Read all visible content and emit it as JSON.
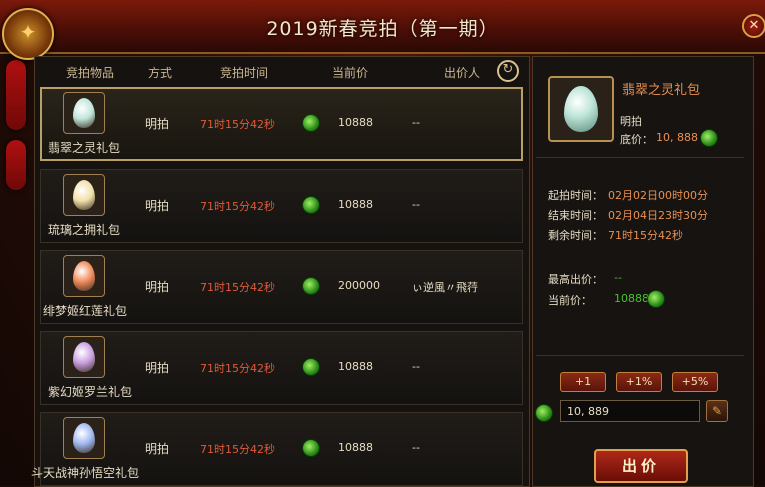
{
  "window": {
    "title": "2019新春竞拍（第一期）"
  },
  "columns": {
    "item": "竞拍物品",
    "mode": "方式",
    "time": "竞拍时间",
    "price": "当前价",
    "bidder": "出价人"
  },
  "rows": [
    {
      "name": "翡翠之灵礼包",
      "mode": "明拍",
      "time": "71时15分42秒",
      "price": "10888",
      "bidder": "--",
      "egg_color": "#bfe6d8"
    },
    {
      "name": "琉璃之拥礼包",
      "mode": "明拍",
      "time": "71时15分42秒",
      "price": "10888",
      "bidder": "--",
      "egg_color": "#f0e0a8"
    },
    {
      "name": "绯梦姬红莲礼包",
      "mode": "明拍",
      "time": "71时15分42秒",
      "price": "200000",
      "bidder": "ぃ逆風〃飛荇",
      "egg_color": "#f08a5a"
    },
    {
      "name": "紫幻姬罗兰礼包",
      "mode": "明拍",
      "time": "71时15分42秒",
      "price": "10888",
      "bidder": "--",
      "egg_color": "#c8a0e0"
    },
    {
      "name": "斗天战神孙悟空礼包",
      "mode": "明拍",
      "time": "71时15分42秒",
      "price": "10888",
      "bidder": "--",
      "egg_color": "#a0b8f0"
    }
  ],
  "detail": {
    "name": "翡翠之灵礼包",
    "mode": "明拍",
    "base_label": "底价：",
    "base_value": "10, 888",
    "start_label": "起拍时间：",
    "start_value": "02月02日00时00分",
    "end_label": "结束时间：",
    "end_value": "02月04日23时30分",
    "remain_label": "剩余时间：",
    "remain_value": "71时15分42秒",
    "highest_label": "最高出价：",
    "highest_value": "--",
    "current_label": "当前价：",
    "current_value": "10888"
  },
  "increments": [
    "+1",
    "+1%",
    "+5%"
  ],
  "bid_input": {
    "value": "10, 889"
  },
  "bid_button": "出价",
  "colors": {
    "accent": "#e89050",
    "time": "#e05a3a",
    "green": "#4ac030"
  }
}
